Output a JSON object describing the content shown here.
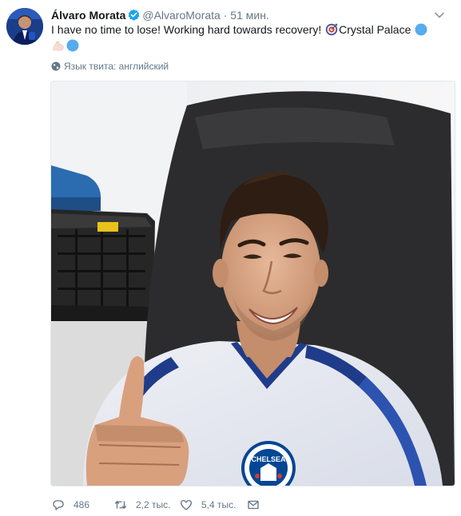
{
  "tweet": {
    "author_name": "Álvaro Morata",
    "handle": "@AlvaroMorata",
    "separator": "·",
    "time": "51 мин.",
    "text_main": "I have no time to lose! Working hard towards recovery! ",
    "text_location": "Crystal Palace",
    "language_label": "Язык твита: английский"
  },
  "actions": {
    "reply_count": "486",
    "retweet_count": "2,2 тыс.",
    "like_count": "5,4 тыс."
  },
  "photo": {
    "shirt_crest_text": "CHELSEA"
  },
  "icons": {
    "verified": "verified-badge-icon",
    "caret": "chevron-down-icon",
    "globe": "globe-icon",
    "target_emoji": "target-icon",
    "blue_circle_emoji": "blue-circle-icon",
    "flexed_biceps_emoji": "flexed-biceps-icon",
    "reply": "reply-icon",
    "retweet": "retweet-icon",
    "like": "heart-icon",
    "message": "envelope-icon"
  },
  "colors": {
    "name_text": "#14171a",
    "secondary_text": "#657786",
    "verified_blue": "#1da1f2",
    "chelsea_blue": "#034694"
  }
}
